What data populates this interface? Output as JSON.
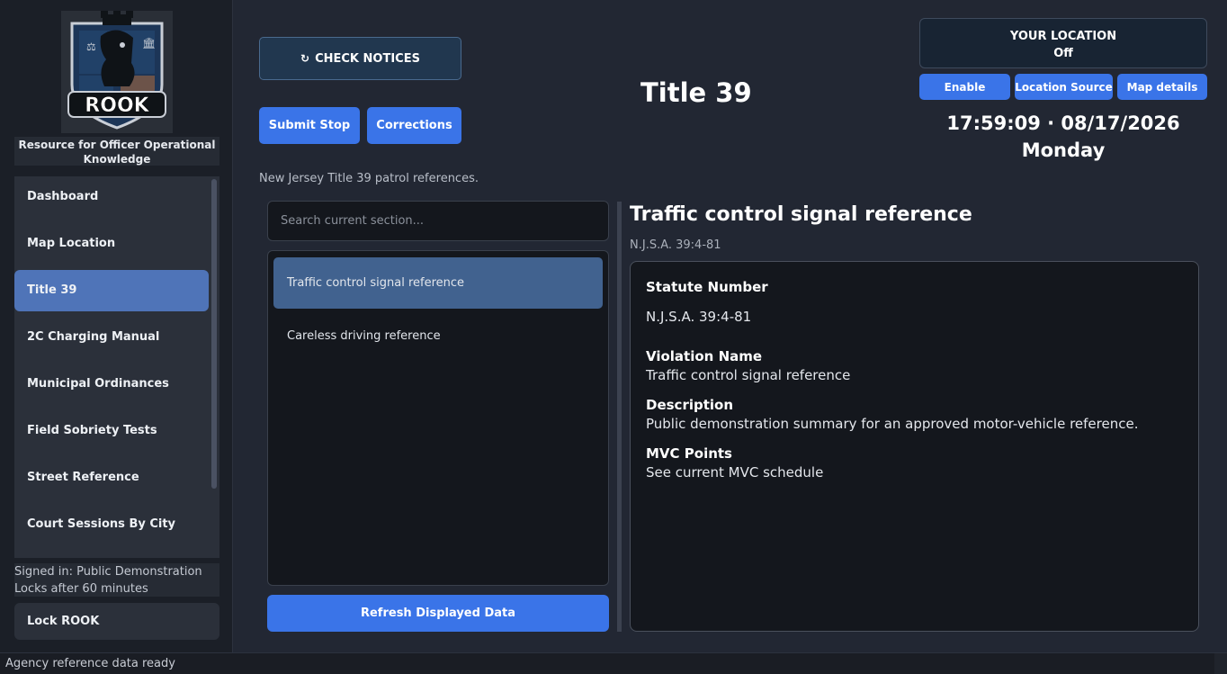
{
  "sidebar": {
    "logo_text": "ROOK",
    "tagline": "Resource for Officer Operational Knowledge",
    "items": [
      {
        "label": "Dashboard"
      },
      {
        "label": "Map  Location"
      },
      {
        "label": "Title 39"
      },
      {
        "label": "2C Charging Manual"
      },
      {
        "label": "Municipal Ordinances"
      },
      {
        "label": "Field Sobriety Tests"
      },
      {
        "label": "Street Reference"
      },
      {
        "label": "Court Sessions By City"
      }
    ],
    "active_index": 2,
    "signed_in": "Signed in: Public Demonstration",
    "lock_note": "Locks after 60 minutes",
    "lock_button": "Lock ROOK"
  },
  "toolbar": {
    "check_notices": "CHECK NOTICES",
    "submit_stop": "Submit Stop",
    "corrections": "Corrections"
  },
  "page": {
    "title": "Title 39",
    "subtitle": "New Jersey Title 39 patrol references."
  },
  "location": {
    "heading": "YOUR LOCATION",
    "status": "Off",
    "buttons": {
      "enable": "Enable",
      "source": "Location Source",
      "details": "Map  details"
    }
  },
  "clock": {
    "time_date": "17:59:09 · 08/17/2026",
    "weekday": "Monday"
  },
  "search": {
    "placeholder": "Search current section..."
  },
  "list": {
    "items": [
      {
        "label": "Traffic control signal reference"
      },
      {
        "label": "Careless driving reference"
      }
    ],
    "selected_index": 0,
    "refresh_button": "Refresh Displayed Data"
  },
  "detail": {
    "title": "Traffic control signal reference",
    "citation": "N.J.S.A. 39:4-81",
    "fields": [
      {
        "label": "Statute Number",
        "value": "N.J.S.A. 39:4-81"
      },
      {
        "label": "Violation Name",
        "value": "Traffic control signal reference"
      },
      {
        "label": "Description",
        "value": "Public demonstration summary for an approved motor-vehicle reference."
      },
      {
        "label": "MVC Points",
        "value": "See current MVC schedule"
      }
    ]
  },
  "status_bar": {
    "message": "Agency reference data ready"
  },
  "colors": {
    "accent": "#3a74e8",
    "active_nav": "#4f74b8",
    "selected_item": "#41628f",
    "background": "#222733"
  }
}
